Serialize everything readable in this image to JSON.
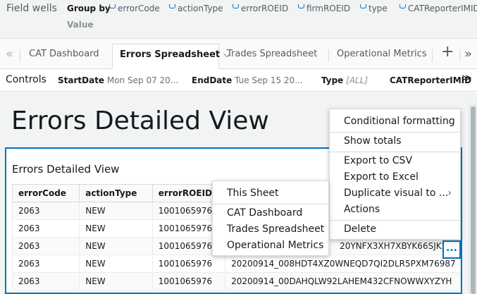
{
  "field_wells": {
    "title": "Field wells",
    "group_by_label": "Group by",
    "value_label": "Value",
    "group_by_fields": [
      "errorCode",
      "actionType",
      "errorROEID",
      "firmROEID",
      "type",
      "CATReporterIMID"
    ]
  },
  "tabs": {
    "items": [
      "CAT Dashboard",
      "Errors Spreadsheet",
      "Trades Spreadsheet",
      "Operational Metrics"
    ],
    "active": "Errors Spreadsheet",
    "add_icon": "plus-icon",
    "prev_icon": "double-chevron-left-icon",
    "next_icon": "double-chevron-right-icon"
  },
  "controls": {
    "title": "Controls",
    "start_date_label": "StartDate",
    "start_date_value": "Mon Sep 07 20...",
    "end_date_label": "EndDate",
    "end_date_value": "Tue Sep 15 20...",
    "type_label": "Type",
    "type_value": "[ALL]",
    "reporter_label": "CATReporterIMID"
  },
  "sheet": {
    "title": "Errors Detailed View"
  },
  "visual": {
    "title": "Errors Detailed View",
    "columns": [
      "errorCode",
      "actionType",
      "errorROEID"
    ],
    "rows": [
      [
        "2063",
        "NEW",
        "1001065976",
        ""
      ],
      [
        "2063",
        "NEW",
        "1001065976",
        ""
      ],
      [
        "2063",
        "NEW",
        "1001065976",
        "20YNFX3XH7XBYK66SJK2MC"
      ],
      [
        "2063",
        "NEW",
        "1001065976",
        "20200914_008HDT4XZ0WNEQD7QI2DLR5PXM76987"
      ],
      [
        "2063",
        "NEW",
        "1001065976",
        "20200914_00DAHQLW92LAHEM432CFNOWWXYZYH"
      ]
    ],
    "more_label": "..."
  },
  "visual_menu": {
    "items": [
      "Conditional formatting",
      "Show totals",
      "Export to CSV",
      "Export to Excel",
      "Duplicate visual to ...",
      "Actions",
      "Delete"
    ]
  },
  "duplicate_submenu": {
    "items": [
      "This Sheet",
      "CAT Dashboard",
      "Trades Spreadsheet",
      "Operational Metrics"
    ]
  },
  "colors": {
    "accent": "#0073bb",
    "background": "#f2f3f3"
  }
}
